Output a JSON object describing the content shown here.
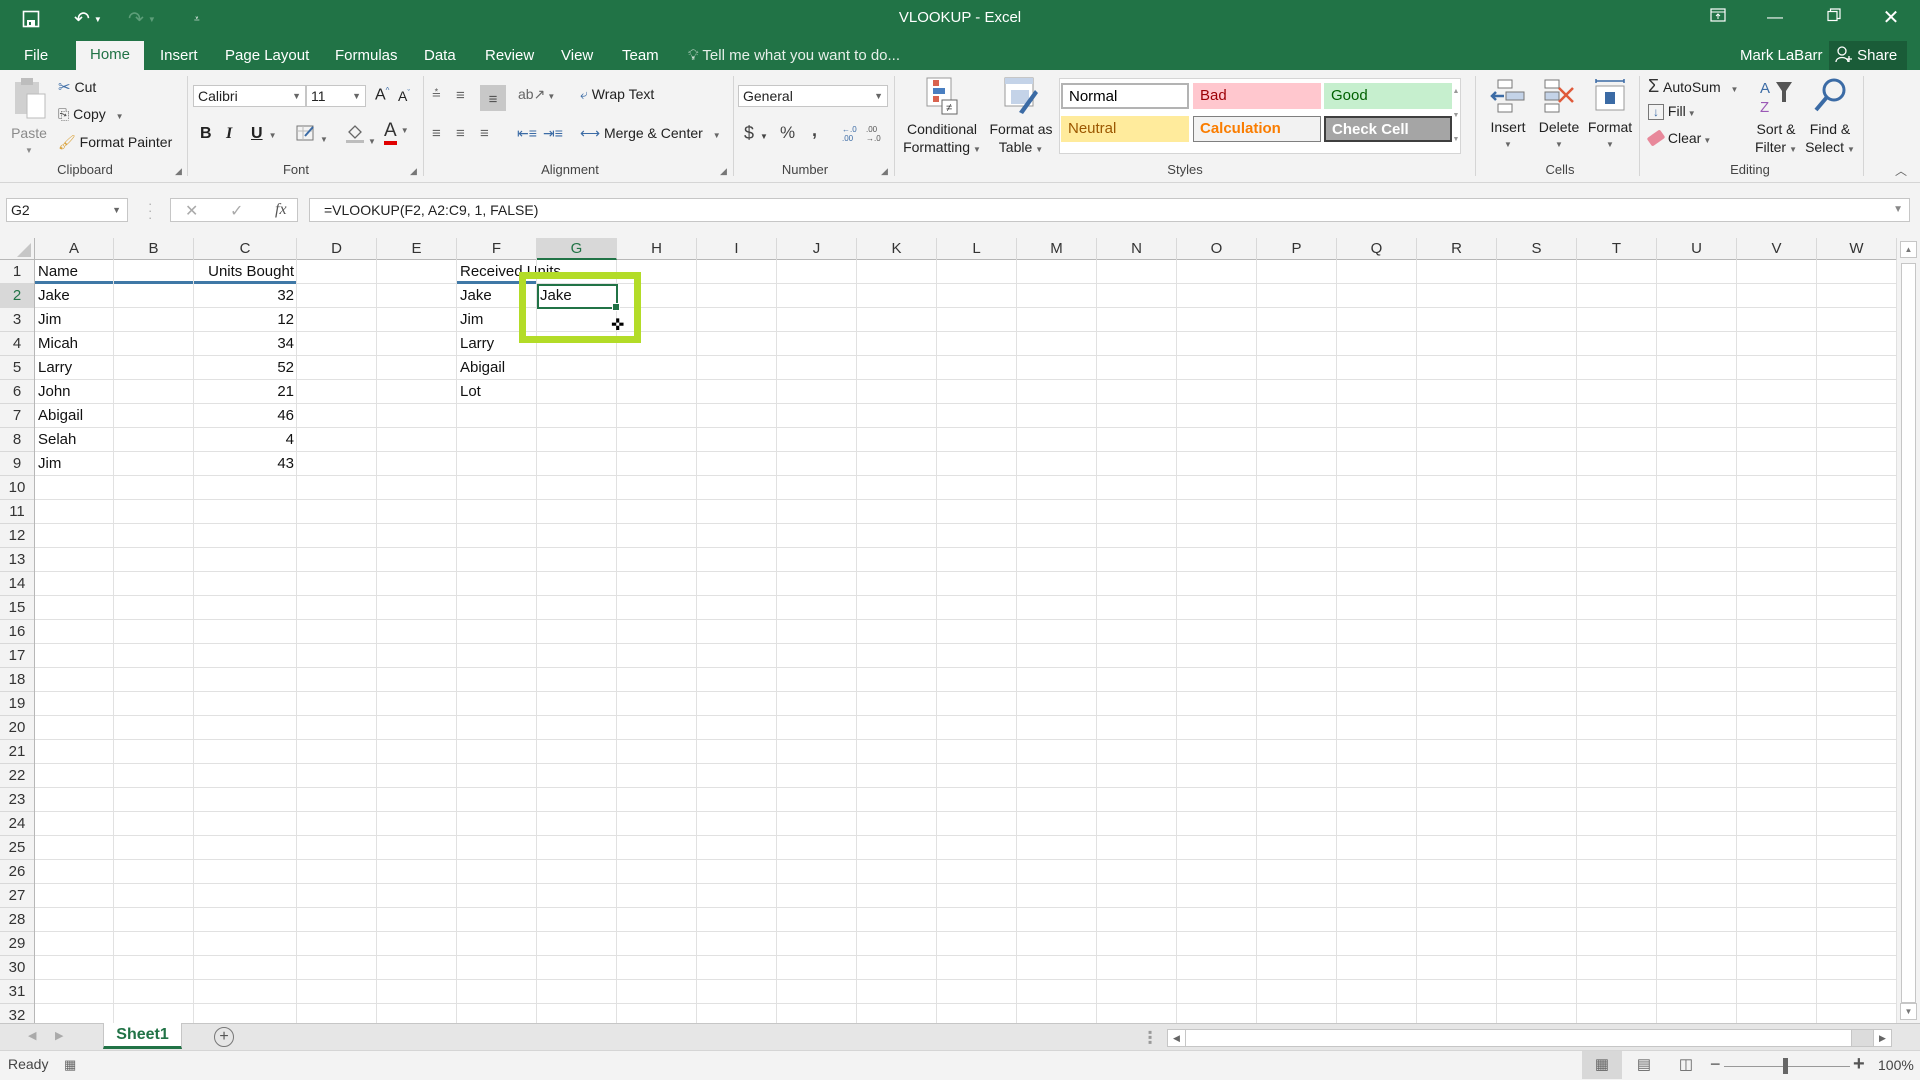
{
  "window": {
    "title": "VLOOKUP - Excel",
    "buttons": [
      "ribbon-display-options",
      "minimize",
      "restore",
      "close"
    ]
  },
  "quick_access": {
    "save_icon": "save-icon",
    "undo_icon": "undo-icon",
    "redo_icon": "redo-icon",
    "customize_icon": "customize-qat-icon"
  },
  "tabs": [
    {
      "label": "File"
    },
    {
      "label": "Home",
      "active": true
    },
    {
      "label": "Insert"
    },
    {
      "label": "Page Layout"
    },
    {
      "label": "Formulas"
    },
    {
      "label": "Data"
    },
    {
      "label": "Review"
    },
    {
      "label": "View"
    },
    {
      "label": "Team"
    }
  ],
  "tell_me": "Tell me what you want to do...",
  "user": "Mark LaBarr",
  "share": "Share",
  "ribbon": {
    "clipboard": {
      "label": "Clipboard",
      "paste": "Paste",
      "cut": "Cut",
      "copy": "Copy",
      "format_painter": "Format Painter"
    },
    "font": {
      "label": "Font",
      "font_name": "Calibri",
      "font_size": "11",
      "bold": "B",
      "italic": "I",
      "underline": "U",
      "increase": "A",
      "decrease": "A",
      "font_color": "#e00000",
      "font_color_glyph": "A"
    },
    "alignment": {
      "label": "Alignment",
      "wrap_text": "Wrap Text",
      "merge_center": "Merge & Center"
    },
    "number": {
      "label": "Number",
      "format": "General",
      "currency": "$",
      "percent": "%",
      "comma": ",",
      "inc_decimal": "←.0\n.00",
      "dec_decimal": ".00\n→.0"
    },
    "styles": {
      "label": "Styles",
      "conditional_formatting": [
        "Conditional",
        "Formatting"
      ],
      "format_as_table": [
        "Format as",
        "Table"
      ],
      "cells": [
        {
          "label": "Normal",
          "bg": "#ffffff",
          "fg": "#000000",
          "border": "#b3b3b3"
        },
        {
          "label": "Bad",
          "bg": "#ffc7ce",
          "fg": "#9c0006",
          "border": "#ffc7ce"
        },
        {
          "label": "Good",
          "bg": "#c6efce",
          "fg": "#006100",
          "border": "#c6efce"
        },
        {
          "label": "Neutral",
          "bg": "#ffeb9c",
          "fg": "#9c5700",
          "border": "#ffeb9c"
        },
        {
          "label": "Calculation",
          "bg": "#f2f2f2",
          "fg": "#fa7d00",
          "border": "#7f7f7f"
        },
        {
          "label": "Check Cell",
          "bg": "#a5a5a5",
          "fg": "#ffffff",
          "border": "#3f3f3f"
        }
      ]
    },
    "cells": {
      "label": "Cells",
      "insert": "Insert",
      "delete": "Delete",
      "format": "Format"
    },
    "editing": {
      "label": "Editing",
      "autosum": "AutoSum",
      "fill": "Fill",
      "clear": "Clear",
      "sort_filter": [
        "Sort &",
        "Filter"
      ],
      "find_select": [
        "Find &",
        "Select"
      ]
    }
  },
  "formula_bar": {
    "name_box": "G2",
    "cancel": "✕",
    "enter": "✓",
    "fx": "fx",
    "formula": "=VLOOKUP(F2, A2:C9, 1, FALSE)"
  },
  "sheet": {
    "columns": [
      "A",
      "B",
      "C",
      "D",
      "E",
      "F",
      "G",
      "H",
      "I",
      "J",
      "K",
      "L",
      "M",
      "N",
      "O",
      "P",
      "Q",
      "R",
      "S",
      "T",
      "U",
      "V",
      "W"
    ],
    "selected_column": "G",
    "rows": [
      "1",
      "2",
      "3",
      "4",
      "5",
      "6",
      "7",
      "8",
      "9",
      "10",
      "11",
      "12",
      "13",
      "14",
      "15",
      "16",
      "17",
      "18",
      "19",
      "20",
      "21",
      "22",
      "23",
      "24",
      "25",
      "26",
      "27",
      "28",
      "29",
      "30",
      "31",
      "32"
    ],
    "selected_row": "2",
    "active_cell": "G2",
    "table1": {
      "headers": {
        "A1": "Name",
        "C1": "Units Bought"
      },
      "rows": [
        {
          "name": "Jake",
          "units": "32"
        },
        {
          "name": "Jim",
          "units": "12"
        },
        {
          "name": "Micah",
          "units": "34"
        },
        {
          "name": "Larry",
          "units": "52"
        },
        {
          "name": "John",
          "units": "21"
        },
        {
          "name": "Abigail",
          "units": "46"
        },
        {
          "name": "Selah",
          "units": "4"
        },
        {
          "name": "Jim",
          "units": "43"
        }
      ]
    },
    "table2": {
      "header": "Received Units",
      "names": [
        "Jake",
        "Jim",
        "Larry",
        "Abigail",
        "Lot"
      ],
      "results": [
        "Jake"
      ]
    },
    "highlight_color": "#b3dc28"
  },
  "sheet_tabs": {
    "tabs": [
      "Sheet1"
    ],
    "active": "Sheet1",
    "add": "+"
  },
  "status": {
    "ready": "Ready",
    "zoom": "100%"
  }
}
